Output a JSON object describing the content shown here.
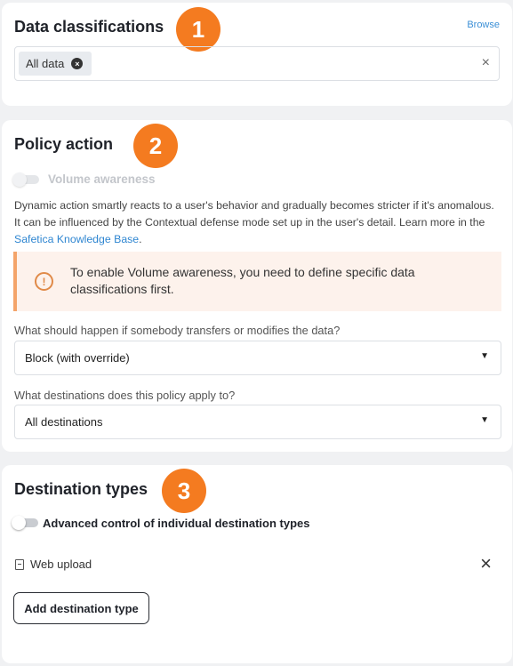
{
  "classifications": {
    "title": "Data classifications",
    "badge": "1",
    "browse_label": "Browse",
    "chip_label": "All data",
    "chip_remove": "×",
    "clear": "×"
  },
  "policy": {
    "title": "Policy action",
    "badge": "2",
    "volume_toggle_label": "Volume awareness",
    "volume_toggle_on": false,
    "volume_toggle_disabled": true,
    "description": "Dynamic action smartly reacts to a user's behavior and gradually becomes stricter if it's anomalous. It can be influenced by the Contextual defense mode set up in the user's detail. Learn more in the ",
    "kb_link": "Safetica Knowledge Base",
    "description_end": ".",
    "warning_icon": "!",
    "warning_text": "To enable Volume awareness, you need to define specific data classifications first.",
    "action_question": "What should happen if somebody transfers or modifies the data?",
    "action_value": "Block (with override)",
    "destination_question": "What destinations does this policy apply to?",
    "destination_value": "All destinations",
    "caret": "▼"
  },
  "destinations": {
    "title": "Destination types",
    "badge": "3",
    "advanced_toggle_label": "Advanced control of individual destination types",
    "advanced_toggle_on": false,
    "items": [
      {
        "label": "Web upload",
        "icon": "document-icon"
      }
    ],
    "remove": "×",
    "add_button_label": "Add destination type"
  },
  "colors": {
    "accent": "#f47b20",
    "link": "#2f86d1",
    "warning_bg": "#fdf2ec",
    "warning_border": "#f4a46a"
  }
}
